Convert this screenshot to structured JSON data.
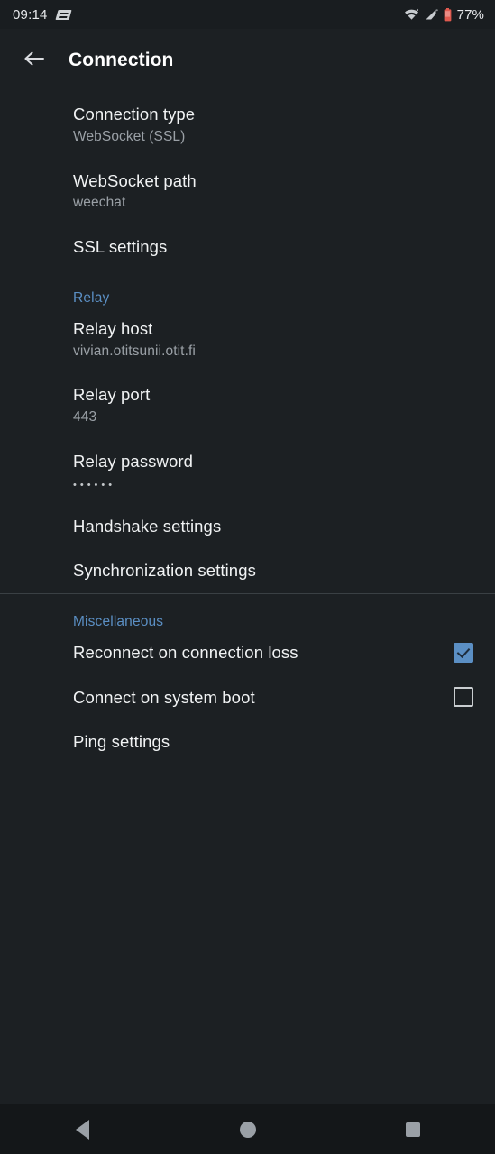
{
  "statusbar": {
    "clock": "09:14",
    "app_icon": "app-badge-icon",
    "wifi_icon": "wifi-icon",
    "signal_icon": "cellular-signal-icon",
    "battery_icon": "battery-low-icon",
    "battery_percent": "77%",
    "battery_color": "#e05a4f"
  },
  "toolbar": {
    "back_icon": "back-arrow-icon",
    "title": "Connection"
  },
  "theme": {
    "background": "#1c2023",
    "statusbar_bg": "#191d20",
    "accent": "#5b8fc4",
    "primary_text": "#f1f3f4",
    "secondary_text": "#9aa0a6",
    "divider": "#3a4044"
  },
  "groups": [
    {
      "header": null,
      "items": [
        {
          "title": "Connection type",
          "summary": "WebSocket (SSL)",
          "widget": "none"
        },
        {
          "title": "WebSocket path",
          "summary": "weechat",
          "widget": "none"
        },
        {
          "title": "SSL settings",
          "summary": null,
          "widget": "none"
        }
      ]
    },
    {
      "header": "Relay",
      "items": [
        {
          "title": "Relay host",
          "summary": "vivian.otitsunii.otit.fi",
          "widget": "none"
        },
        {
          "title": "Relay port",
          "summary": "443",
          "widget": "none"
        },
        {
          "title": "Relay password",
          "summary": "••••••",
          "widget": "none",
          "masked": true
        },
        {
          "title": "Handshake settings",
          "summary": null,
          "widget": "none"
        },
        {
          "title": "Synchronization settings",
          "summary": null,
          "widget": "none"
        }
      ]
    },
    {
      "header": "Miscellaneous",
      "items": [
        {
          "title": "Reconnect on connection loss",
          "summary": null,
          "widget": "checkbox",
          "checked": true
        },
        {
          "title": "Connect on system boot",
          "summary": null,
          "widget": "checkbox",
          "checked": false
        },
        {
          "title": "Ping settings",
          "summary": null,
          "widget": "none"
        }
      ]
    }
  ],
  "navbar": {
    "back": "nav-back-icon",
    "home": "nav-home-icon",
    "recents": "nav-recents-icon"
  }
}
